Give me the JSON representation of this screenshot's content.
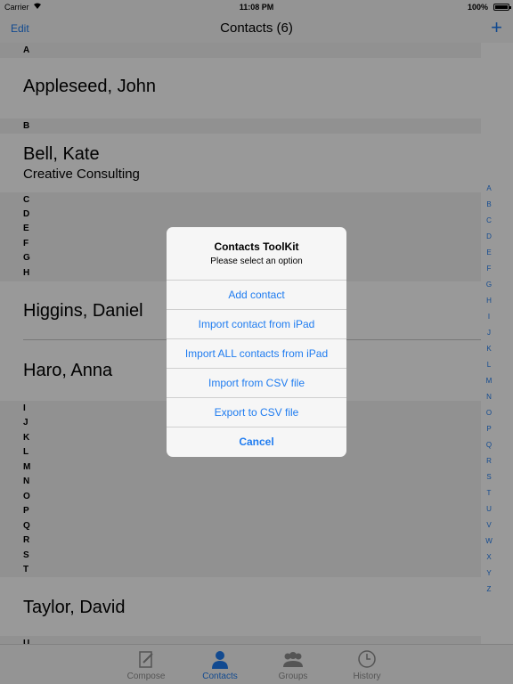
{
  "status_bar": {
    "carrier": "Carrier",
    "time": "11:08 PM",
    "battery": "100%"
  },
  "nav": {
    "edit": "Edit",
    "title": "Contacts (6)",
    "add": "+"
  },
  "sections": {
    "a": "A",
    "b": "B",
    "c": "C",
    "d": "D",
    "e": "E",
    "f": "F",
    "g": "G",
    "h": "H",
    "i": "I",
    "j": "J",
    "k": "K",
    "l": "L",
    "m": "M",
    "n": "N",
    "o": "O",
    "p": "P",
    "q": "Q",
    "r": "R",
    "s": "S",
    "t": "T",
    "u": "U"
  },
  "contacts": {
    "appleseed": {
      "name": "Appleseed, John"
    },
    "bell": {
      "name": "Bell, Kate",
      "company": "Creative Consulting"
    },
    "higgins": {
      "name": "Higgins, Daniel"
    },
    "haro": {
      "name": "Haro, Anna"
    },
    "taylor": {
      "name": "Taylor, David"
    }
  },
  "index": [
    "A",
    "B",
    "C",
    "D",
    "E",
    "F",
    "G",
    "H",
    "I",
    "J",
    "K",
    "L",
    "M",
    "N",
    "O",
    "P",
    "Q",
    "R",
    "S",
    "T",
    "U",
    "V",
    "W",
    "X",
    "Y",
    "Z"
  ],
  "alert": {
    "title": "Contacts ToolKit",
    "message": "Please select an option",
    "buttons": {
      "add": "Add contact",
      "import_one": "Import contact from iPad",
      "import_all": "Import ALL contacts from iPad",
      "import_csv": "Import from CSV file",
      "export_csv": "Export to CSV file",
      "cancel": "Cancel"
    }
  },
  "tabs": {
    "compose": "Compose",
    "contacts": "Contacts",
    "groups": "Groups",
    "history": "History"
  },
  "colors": {
    "accent": "#1f7cf0",
    "dim": "rgba(0,0,0,0.4)"
  }
}
